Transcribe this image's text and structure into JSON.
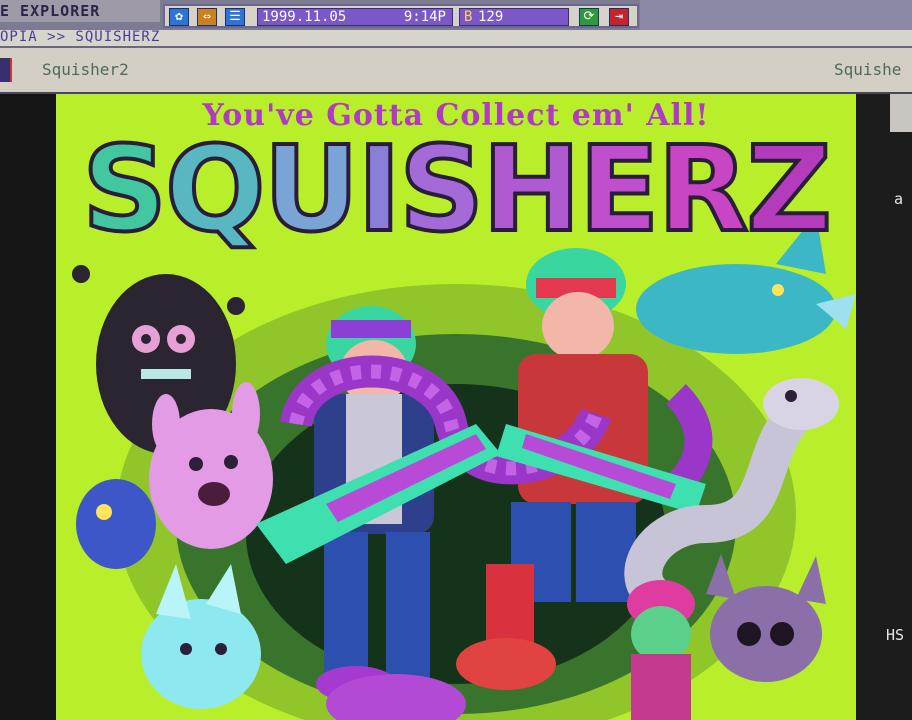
{
  "topbar": {
    "app_title": "E EXPLORER",
    "date": "1999.11.05",
    "time": "9:14P",
    "counter": "129",
    "counter_prefix": "B",
    "icons": [
      "settings-icon",
      "arrows-icon",
      "menu-icon",
      "refresh-icon",
      "exit-icon"
    ]
  },
  "address": {
    "path": "OPIA >> SQUISHERZ"
  },
  "tabs": {
    "active_label": "Squisher2",
    "right_label": "Squishe"
  },
  "side_panel": {
    "text_a": "a",
    "text_hs": "HS"
  },
  "artwork": {
    "tagline": "You've Gotta Collect em' All!",
    "logo_letters": [
      "S",
      "Q",
      "U",
      "I",
      "S",
      "H",
      "E",
      "R",
      "Z"
    ],
    "logo_colors": [
      "#43c7a0",
      "#58b7c0",
      "#7aa4d6",
      "#8a7fd8",
      "#a36ad8",
      "#b05ad2",
      "#bf4fcd",
      "#c845c4",
      "#b53bbd"
    ]
  },
  "colors": {
    "art_background": "#b9ee2a",
    "logo_outline": "#2a1d3a",
    "accent_purple": "#7a58c8"
  }
}
